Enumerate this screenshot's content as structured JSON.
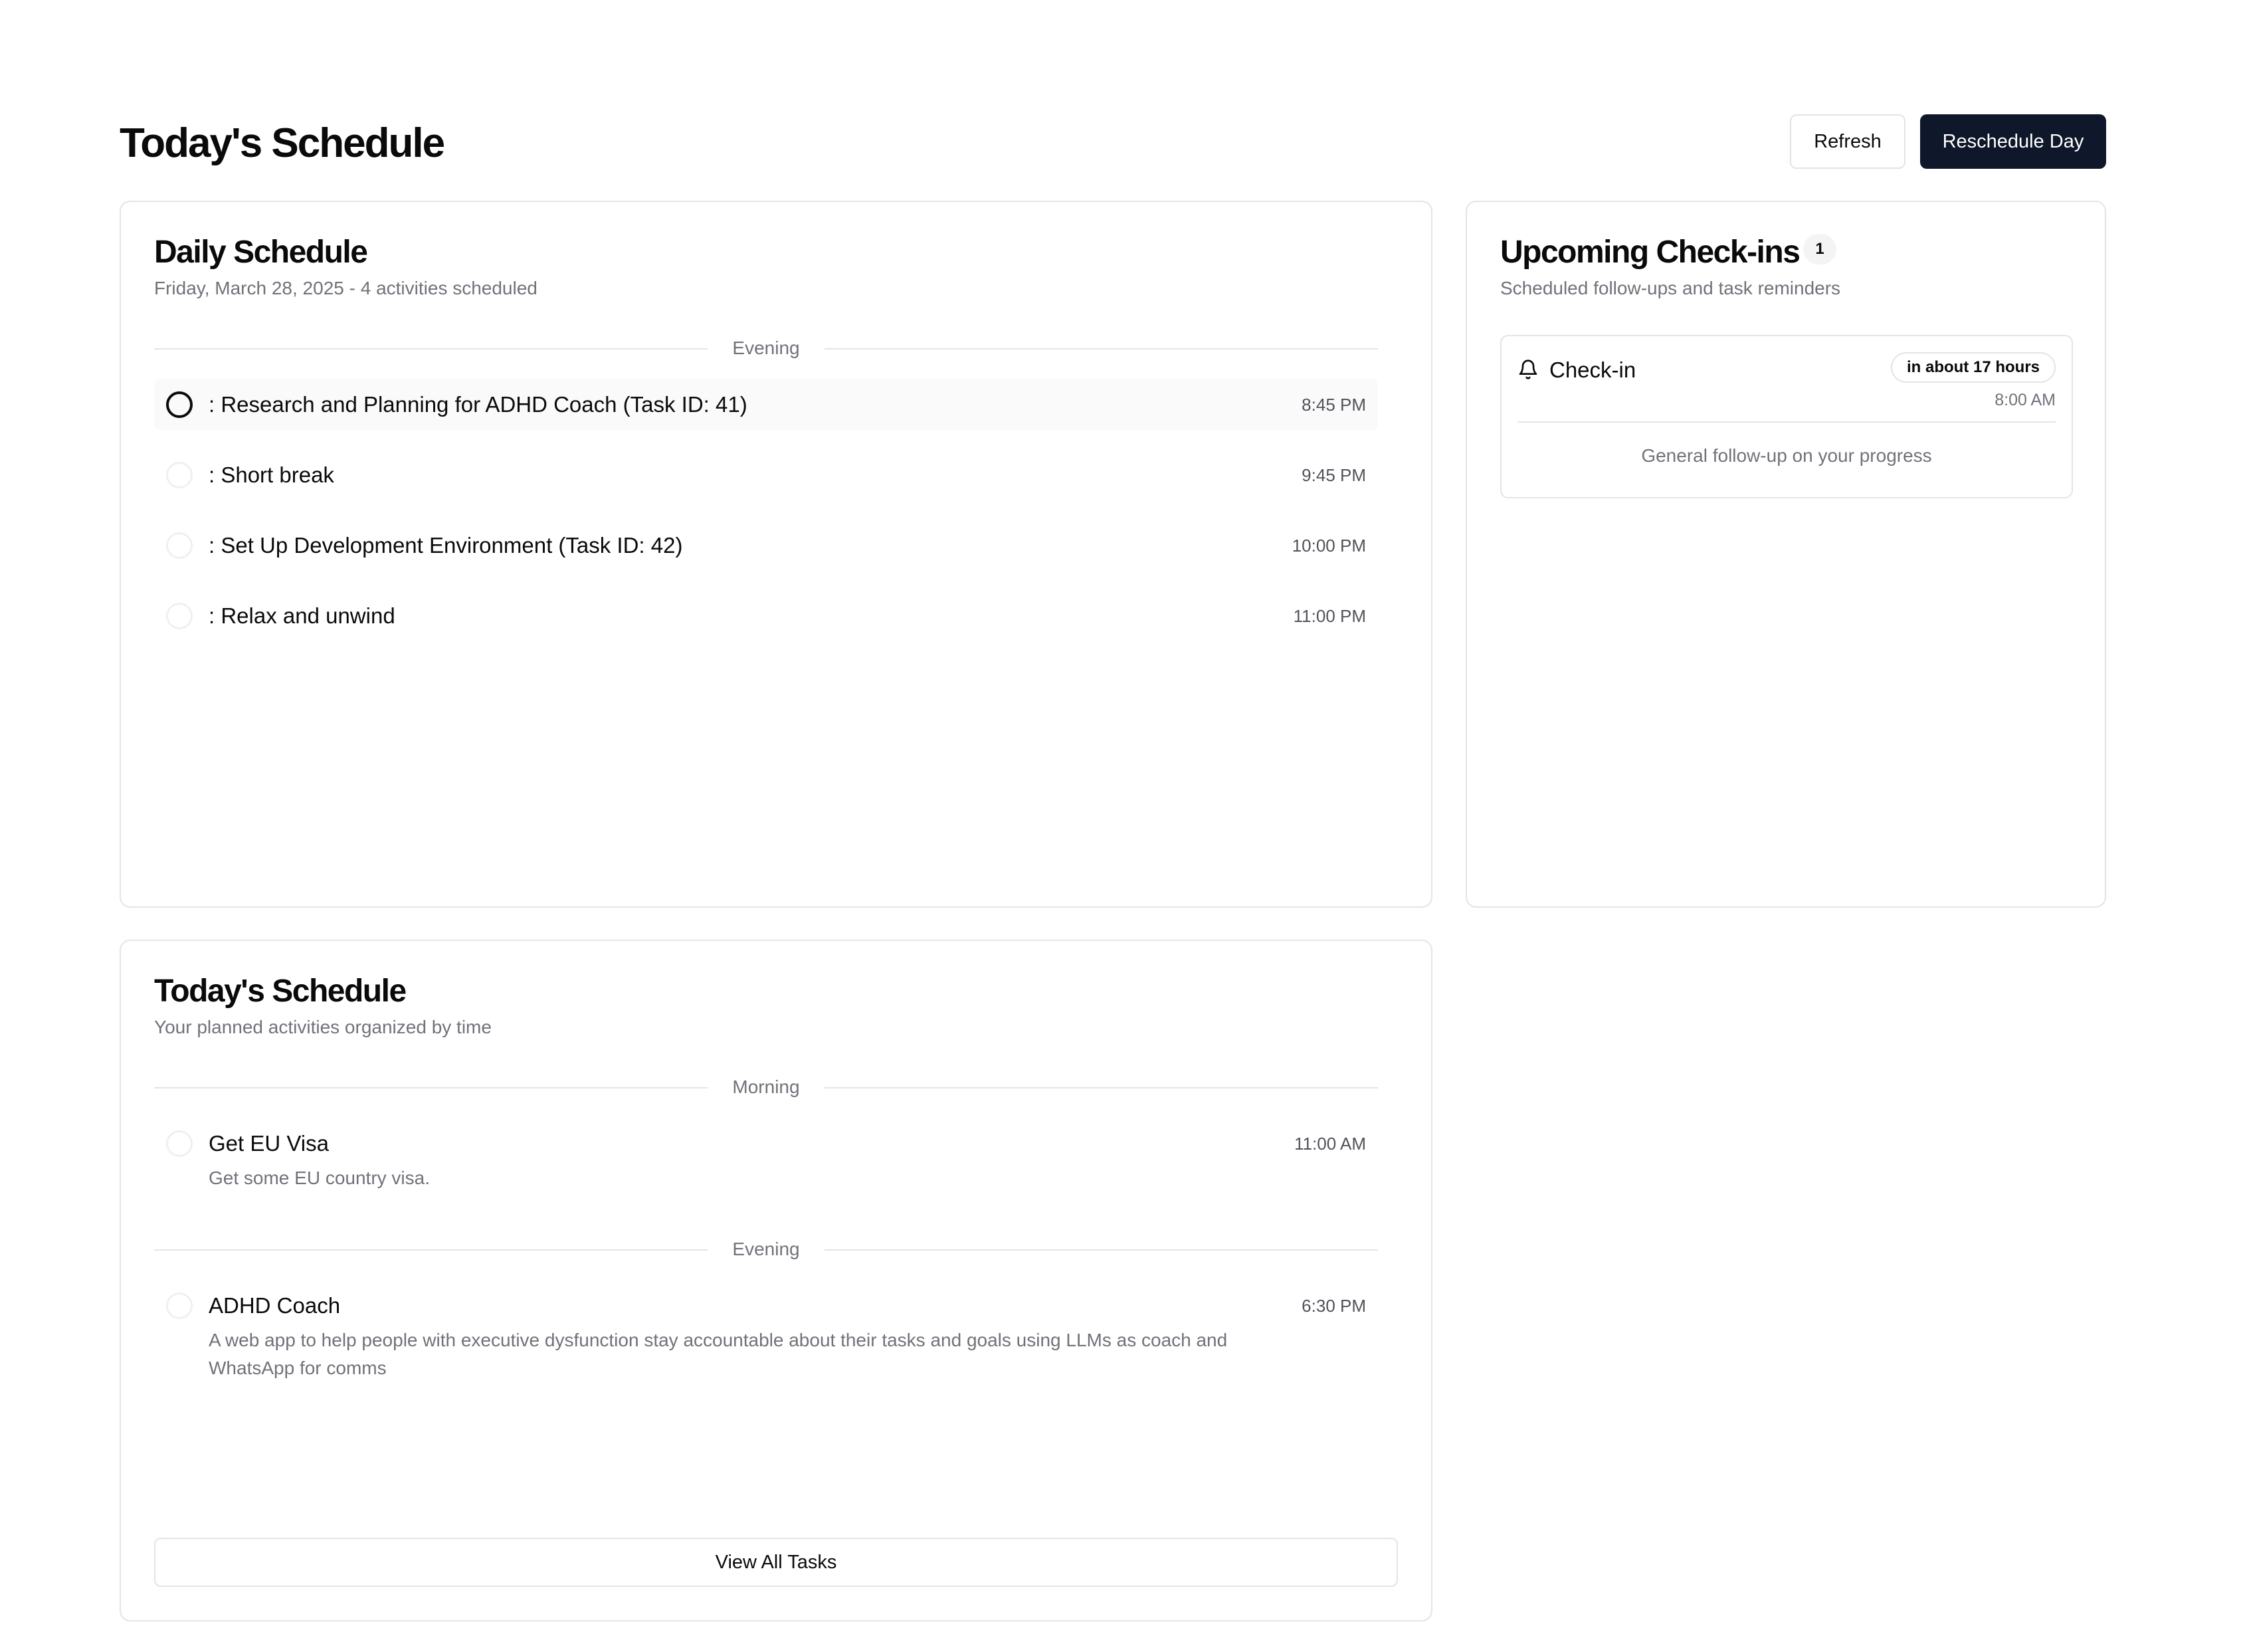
{
  "header": {
    "title": "Today's Schedule",
    "refresh_label": "Refresh",
    "reschedule_label": "Reschedule Day"
  },
  "daily_schedule": {
    "title": "Daily Schedule",
    "subtitle": "Friday, March 28, 2025 - 4 activities scheduled",
    "section_label": "Evening",
    "items": [
      {
        "label": ": Research and Planning for ADHD Coach (Task ID: 41)",
        "time": "8:45 PM"
      },
      {
        "label": ": Short break",
        "time": "9:45 PM"
      },
      {
        "label": ": Set Up Development Environment (Task ID: 42)",
        "time": "10:00 PM"
      },
      {
        "label": ": Relax and unwind",
        "time": "11:00 PM"
      }
    ]
  },
  "checkins": {
    "title": "Upcoming Check-ins",
    "count": "1",
    "subtitle": "Scheduled follow-ups and task reminders",
    "items": [
      {
        "title": "Check-in",
        "relative": "in about 17 hours",
        "time": "8:00 AM",
        "description": "General follow-up on your progress",
        "icon": "bell-icon"
      }
    ]
  },
  "today_schedule": {
    "title": "Today's Schedule",
    "subtitle": "Your planned activities organized by time",
    "sections": [
      {
        "label": "Morning",
        "items": [
          {
            "title": "Get EU Visa",
            "time": "11:00 AM",
            "description": "Get some EU country visa."
          }
        ]
      },
      {
        "label": "Evening",
        "items": [
          {
            "title": "ADHD Coach",
            "time": "6:30 PM",
            "description": "A web app to help people with executive dysfunction stay accountable about their tasks and goals using LLMs as coach and WhatsApp for comms"
          }
        ]
      }
    ],
    "view_all_label": "View All Tasks"
  },
  "colors": {
    "primary_button": "#0f172a",
    "border": "#e4e4e7",
    "muted_text": "#71717a"
  }
}
